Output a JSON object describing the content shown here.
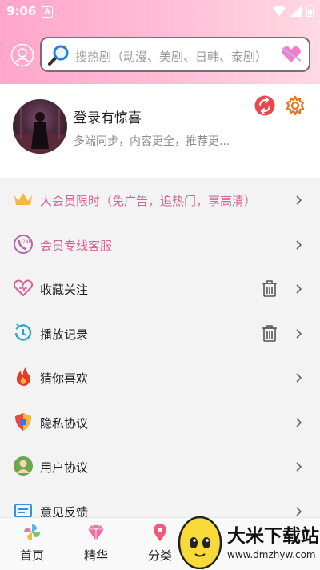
{
  "status": {
    "time": "9:06",
    "a_icon": "A"
  },
  "search": {
    "placeholder": "搜热剧（动漫、美剧、日韩、泰剧）"
  },
  "profile": {
    "name": "登录有惊喜",
    "desc": "多端同步，内容更全，推荐更..."
  },
  "menu": [
    {
      "label": "大会员限时（免广告，追热门，享高清）",
      "icon": "crown-icon"
    },
    {
      "label": "会员专线客服",
      "icon": "phone-24h-icon"
    },
    {
      "label": "收藏关注",
      "icon": "heart-outline-icon"
    },
    {
      "label": "播放记录",
      "icon": "history-icon"
    },
    {
      "label": "猜你喜欢",
      "icon": "fire-icon"
    },
    {
      "label": "隐私协议",
      "icon": "shield-icon"
    },
    {
      "label": "用户协议",
      "icon": "user-badge-icon"
    },
    {
      "label": "意见反馈",
      "icon": "feedback-icon"
    }
  ],
  "tabs": [
    {
      "label": "首页"
    },
    {
      "label": "精华"
    },
    {
      "label": "分类"
    }
  ],
  "watermark": {
    "title": "大米下载站",
    "url": "www.dmzhyw.com"
  },
  "colors": {
    "header_pink": "#ffa6cb",
    "accent_pink": "#d7648f",
    "gear_orange": "#e07a2a",
    "sync_red": "#e8484c"
  }
}
